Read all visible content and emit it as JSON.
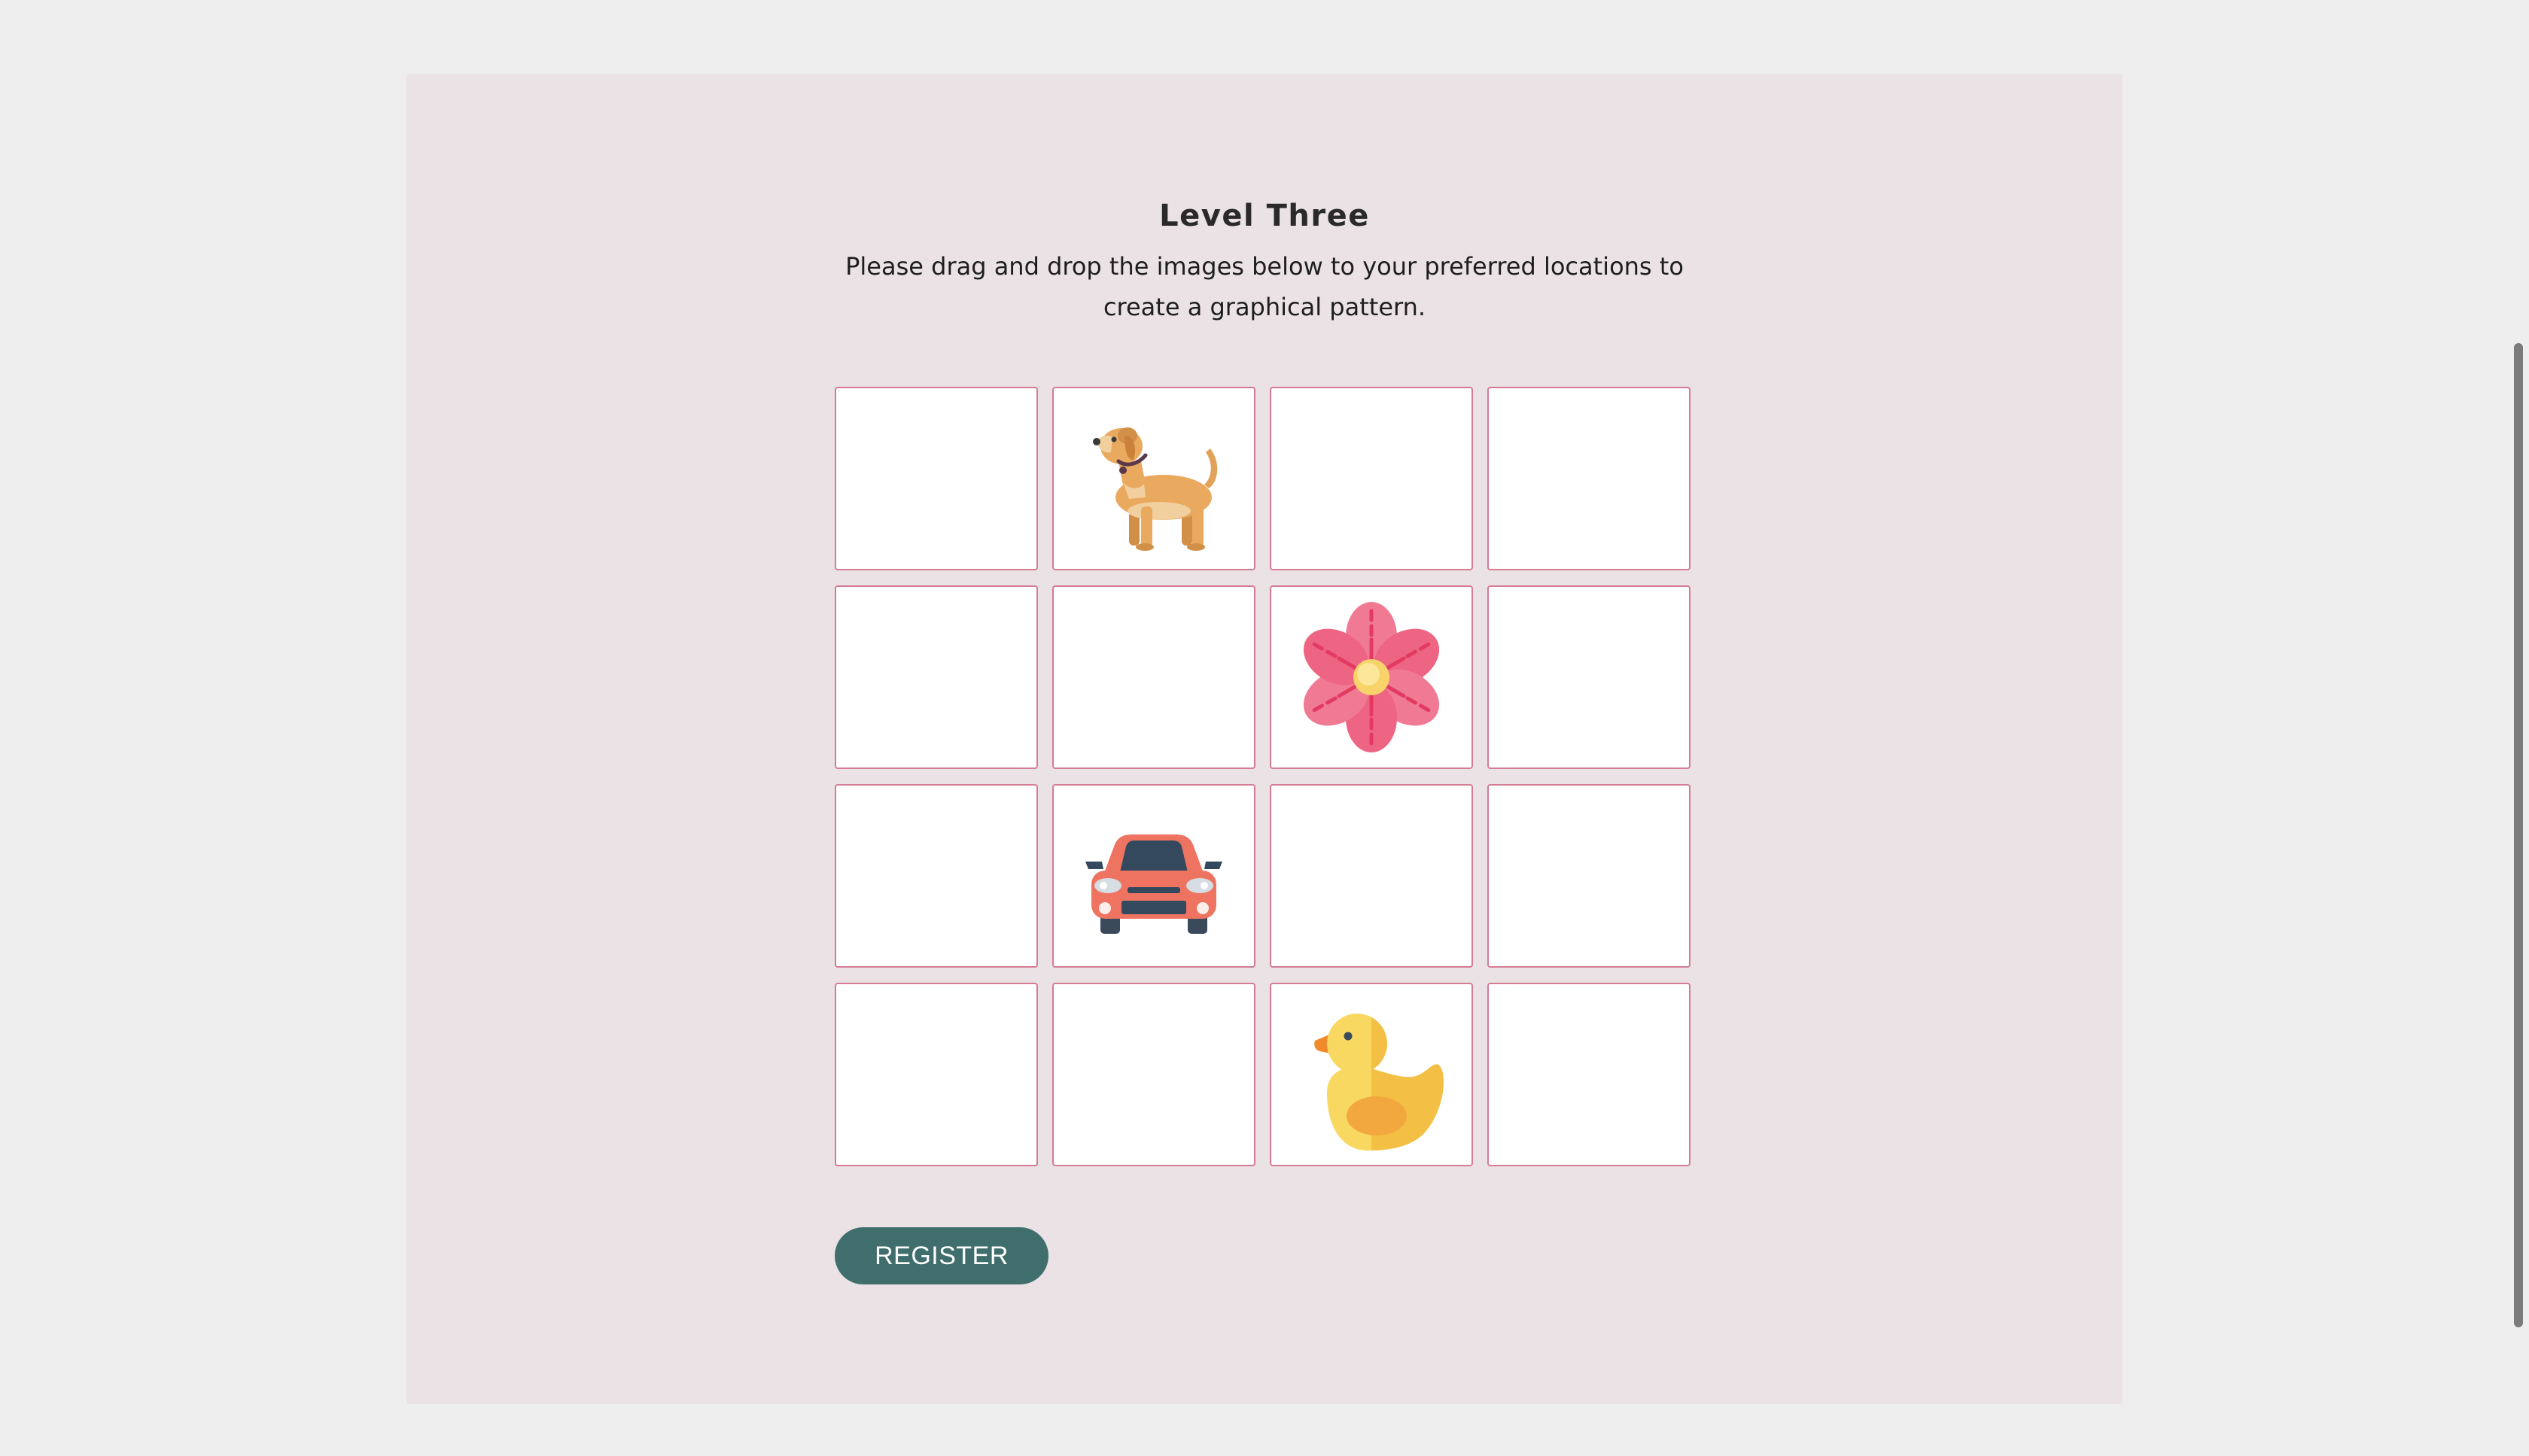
{
  "page": {
    "title": "Level Three",
    "instructions": "Please drag and drop the images below to your preferred locations to create a graphical pattern."
  },
  "grid": {
    "rows": 4,
    "columns": 4,
    "placed_images": [
      {
        "row": 1,
        "column": 2,
        "icon": "dog-icon"
      },
      {
        "row": 2,
        "column": 3,
        "icon": "flower-icon"
      },
      {
        "row": 3,
        "column": 2,
        "icon": "car-icon"
      },
      {
        "row": 4,
        "column": 3,
        "icon": "duck-icon"
      }
    ]
  },
  "actions": {
    "register_label": "REGISTER"
  },
  "colors": {
    "page_background": "#eeeeee",
    "panel_background": "#ebe2e5",
    "cell_border": "#d57c94",
    "button_background": "#3f6e6c"
  }
}
